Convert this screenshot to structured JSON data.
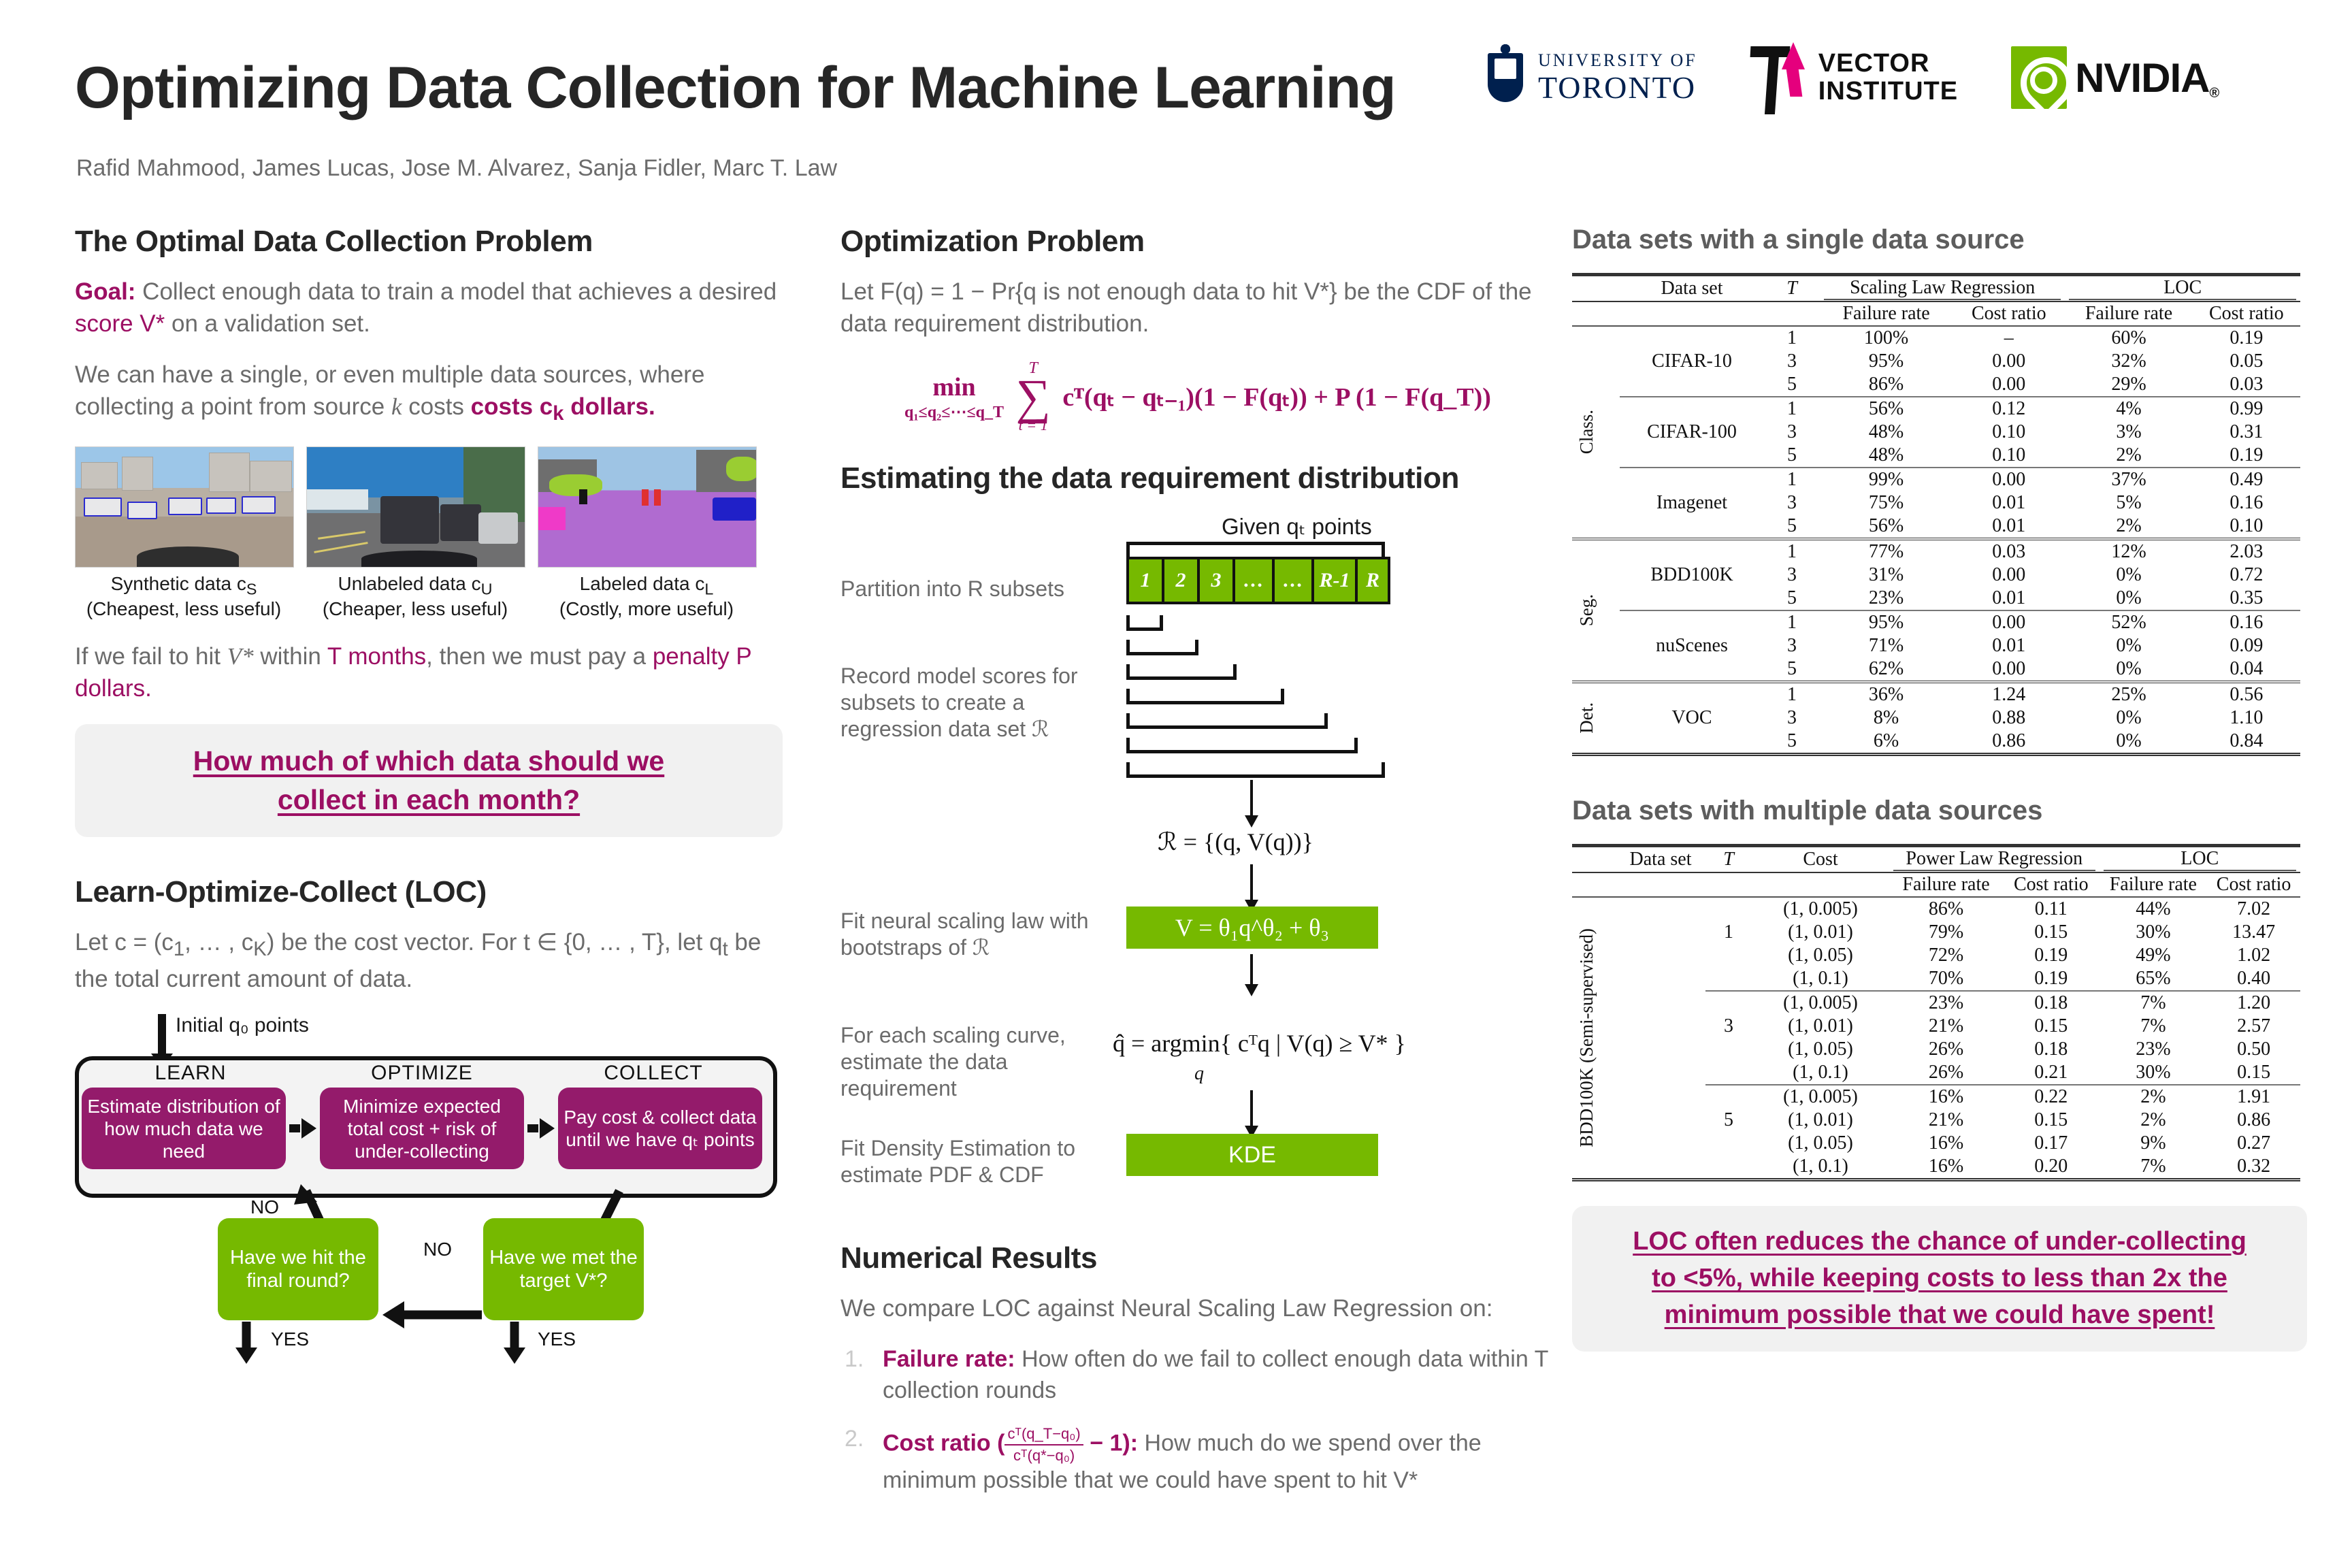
{
  "header": {
    "title": "Optimizing Data Collection for Machine Learning",
    "authors": "Rafid Mahmood, James Lucas, Jose M. Alvarez, Sanja Fidler, Marc T. Law",
    "logos": [
      {
        "name": "university-of-toronto",
        "line1": "UNIVERSITY OF",
        "line2": "TORONTO"
      },
      {
        "name": "vector-institute",
        "line1": "VECTOR",
        "line2": "INSTITUTE"
      },
      {
        "name": "nvidia",
        "wordmark": "NVIDIA",
        "registered": "®"
      }
    ]
  },
  "colors": {
    "magenta": "#9c0f63",
    "green": "#76b900",
    "purple_box": "#941b6b",
    "body_grey": "#6b6b6b",
    "heading": "#262626"
  },
  "section_problem": {
    "heading": "The Optimal Data Collection Problem",
    "goal_label": "Goal:",
    "goal_rest_a": " Collect enough data to train a model that achieves a desired ",
    "goal_highlight": "score V*",
    "goal_rest_b": " on a validation set.",
    "para2_a": "We can have a single, or even multiple data sources, where collecting a point from source ",
    "para2_k": "k",
    "para2_b": " costs ",
    "para2_highlight": "costs c",
    "para2_sub": "k",
    "para2_c": " dollars.",
    "images": [
      {
        "caption_line1": "Synthetic data c",
        "caption_sub": "S",
        "caption_line2": "(Cheapest, less useful)",
        "name": "synthetic-data-thumbnail"
      },
      {
        "caption_line1": "Unlabeled data c",
        "caption_sub": "U",
        "caption_line2": "(Cheaper, less useful)",
        "name": "unlabeled-data-thumbnail"
      },
      {
        "caption_line1": "Labeled data c",
        "caption_sub": "L",
        "caption_line2": "(Costly, more useful)",
        "name": "labeled-data-thumbnail"
      }
    ],
    "penalty_a": "If we fail to hit ",
    "penalty_v": "V*",
    "penalty_b": " within ",
    "penalty_T": "T months",
    "penalty_c": ", then we must pay a ",
    "penalty_d": "penalty P dollars.",
    "callout_line1": "How much of which data should we",
    "callout_line2": "collect in each month?"
  },
  "section_loc": {
    "heading": "Learn-Optimize-Collect (LOC)",
    "intro_a": "Let c = (c",
    "intro_sub1": "1",
    "intro_b": ", … , c",
    "intro_subK": "K",
    "intro_c": ") be the cost vector. For t ∈ {0, … , T}, let q",
    "intro_subt": "t",
    "intro_d": " be the total current amount of data.",
    "initial_label": "Initial q₀ points",
    "loop_labels": [
      "LEARN",
      "OPTIMIZE",
      "COLLECT"
    ],
    "steps": [
      "Estimate distribution of how much data we need",
      "Minimize expected total cost + risk of under-collecting",
      "Pay cost & collect data until we have qₜ points"
    ],
    "decisions": [
      {
        "text": "Have we hit the final round?",
        "name": "decision-final-round"
      },
      {
        "text": "Have we met the target V*?",
        "name": "decision-target-met"
      }
    ],
    "edge_no_1": "NO",
    "edge_no_2": "NO",
    "edge_yes_1": "YES",
    "edge_yes_2": "YES"
  },
  "section_optimization": {
    "heading": "Optimization Problem",
    "text_a": "Let F(q) = 1 − Pr{q is not enough data to hit V*} be the CDF of the data requirement distribution.",
    "equation_min": "min",
    "equation_constraint": "q₁≤q₂≤⋯≤q_T",
    "equation_sum_upper": "T",
    "equation_sum_lower": "t = 1",
    "equation_body": "cᵀ(qₜ − qₜ₋₁)(1 − F(qₜ)) + P (1 − F(q_T))"
  },
  "section_estimating": {
    "heading": "Estimating the data requirement distribution",
    "given_label": "Given qₜ points",
    "partition_label": "Partition into R subsets",
    "subset_cells": [
      "1",
      "2",
      "3",
      "…",
      "…",
      "R-1",
      "R"
    ],
    "record_label": "Record model scores for subsets to create a regression data set ℛ",
    "regression_set": "ℛ = {(q, V(q))}",
    "fit_label": "Fit neural scaling law with bootstraps of ℛ",
    "scaling_law": "V = θ₁q^θ₂ + θ₃",
    "estimate_label": "For each scaling curve, estimate the data requirement",
    "argmin_eq": "q̂ = argmin{ cᵀq | V(q) ≥ V* }",
    "argmin_sub": "q",
    "density_label": "Fit Density Estimation to estimate PDF & CDF",
    "kde_box": "KDE"
  },
  "section_numerical": {
    "heading": "Numerical Results",
    "intro": "We compare LOC against Neural Scaling Law Regression on:",
    "items": [
      {
        "num": "1.",
        "label": "Failure rate:",
        "text": " How often do we fail to collect enough data within T collection rounds"
      },
      {
        "num": "2.",
        "label_a": "Cost ratio (",
        "frac_num": "cᵀ(q_T−q₀)",
        "frac_den": "cᵀ(q*−q₀)",
        "label_b": " − 1):",
        "text": " How much do we spend over the minimum possible that we could have spent to hit V*"
      }
    ]
  },
  "table_single": {
    "heading": "Data sets with a single data source",
    "col_dataset": "Data set",
    "col_T": "T",
    "group_a": "Scaling Law Regression",
    "group_b": "LOC",
    "sub_failure": "Failure rate",
    "sub_cost": "Cost ratio",
    "row_groups": [
      {
        "side": "Class.",
        "blocks": [
          {
            "dataset": "CIFAR-10",
            "rows": [
              {
                "T": "1",
                "slr_fail": "100%",
                "slr_cost": "–",
                "loc_fail": "60%",
                "loc_cost": "0.19"
              },
              {
                "T": "3",
                "slr_fail": "95%",
                "slr_cost": "0.00",
                "loc_fail": "32%",
                "loc_cost": "0.05"
              },
              {
                "T": "5",
                "slr_fail": "86%",
                "slr_cost": "0.00",
                "loc_fail": "29%",
                "loc_cost": "0.03"
              }
            ]
          },
          {
            "dataset": "CIFAR-100",
            "rows": [
              {
                "T": "1",
                "slr_fail": "56%",
                "slr_cost": "0.12",
                "loc_fail": "4%",
                "loc_cost": "0.99"
              },
              {
                "T": "3",
                "slr_fail": "48%",
                "slr_cost": "0.10",
                "loc_fail": "3%",
                "loc_cost": "0.31"
              },
              {
                "T": "5",
                "slr_fail": "48%",
                "slr_cost": "0.10",
                "loc_fail": "2%",
                "loc_cost": "0.19"
              }
            ]
          },
          {
            "dataset": "Imagenet",
            "rows": [
              {
                "T": "1",
                "slr_fail": "99%",
                "slr_cost": "0.00",
                "loc_fail": "37%",
                "loc_cost": "0.49"
              },
              {
                "T": "3",
                "slr_fail": "75%",
                "slr_cost": "0.01",
                "loc_fail": "5%",
                "loc_cost": "0.16"
              },
              {
                "T": "5",
                "slr_fail": "56%",
                "slr_cost": "0.01",
                "loc_fail": "2%",
                "loc_cost": "0.10"
              }
            ]
          }
        ]
      },
      {
        "side": "Seg.",
        "blocks": [
          {
            "dataset": "BDD100K",
            "rows": [
              {
                "T": "1",
                "slr_fail": "77%",
                "slr_cost": "0.03",
                "loc_fail": "12%",
                "loc_cost": "2.03"
              },
              {
                "T": "3",
                "slr_fail": "31%",
                "slr_cost": "0.00",
                "loc_fail": "0%",
                "loc_cost": "0.72"
              },
              {
                "T": "5",
                "slr_fail": "23%",
                "slr_cost": "0.01",
                "loc_fail": "0%",
                "loc_cost": "0.35"
              }
            ]
          },
          {
            "dataset": "nuScenes",
            "rows": [
              {
                "T": "1",
                "slr_fail": "95%",
                "slr_cost": "0.00",
                "loc_fail": "52%",
                "loc_cost": "0.16"
              },
              {
                "T": "3",
                "slr_fail": "71%",
                "slr_cost": "0.01",
                "loc_fail": "0%",
                "loc_cost": "0.09"
              },
              {
                "T": "5",
                "slr_fail": "62%",
                "slr_cost": "0.00",
                "loc_fail": "0%",
                "loc_cost": "0.04"
              }
            ]
          }
        ]
      },
      {
        "side": "Det.",
        "blocks": [
          {
            "dataset": "VOC",
            "rows": [
              {
                "T": "1",
                "slr_fail": "36%",
                "slr_cost": "1.24",
                "loc_fail": "25%",
                "loc_cost": "0.56"
              },
              {
                "T": "3",
                "slr_fail": "8%",
                "slr_cost": "0.88",
                "loc_fail": "0%",
                "loc_cost": "1.10"
              },
              {
                "T": "5",
                "slr_fail": "6%",
                "slr_cost": "0.86",
                "loc_fail": "0%",
                "loc_cost": "0.84"
              }
            ]
          }
        ]
      }
    ]
  },
  "table_multi": {
    "heading": "Data sets with multiple data sources",
    "col_dataset": "Data set",
    "col_T": "T",
    "col_cost": "Cost",
    "group_a": "Power Law Regression",
    "group_b": "LOC",
    "sub_failure": "Failure rate",
    "sub_cost": "Cost ratio",
    "side_label": "BDD100K (Semi-supervised)",
    "blocks": [
      {
        "T": "1",
        "rows": [
          {
            "cost": "(1, 0.005)",
            "plr_fail": "86%",
            "plr_cost": "0.11",
            "loc_fail": "44%",
            "loc_cost": "7.02"
          },
          {
            "cost": "(1, 0.01)",
            "plr_fail": "79%",
            "plr_cost": "0.15",
            "loc_fail": "30%",
            "loc_cost": "13.47"
          },
          {
            "cost": "(1, 0.05)",
            "plr_fail": "72%",
            "plr_cost": "0.19",
            "loc_fail": "49%",
            "loc_cost": "1.02"
          },
          {
            "cost": "(1, 0.1)",
            "plr_fail": "70%",
            "plr_cost": "0.19",
            "loc_fail": "65%",
            "loc_cost": "0.40"
          }
        ]
      },
      {
        "T": "3",
        "rows": [
          {
            "cost": "(1, 0.005)",
            "plr_fail": "23%",
            "plr_cost": "0.18",
            "loc_fail": "7%",
            "loc_cost": "1.20"
          },
          {
            "cost": "(1, 0.01)",
            "plr_fail": "21%",
            "plr_cost": "0.15",
            "loc_fail": "7%",
            "loc_cost": "2.57"
          },
          {
            "cost": "(1, 0.05)",
            "plr_fail": "26%",
            "plr_cost": "0.18",
            "loc_fail": "23%",
            "loc_cost": "0.50"
          },
          {
            "cost": "(1, 0.1)",
            "plr_fail": "26%",
            "plr_cost": "0.21",
            "loc_fail": "30%",
            "loc_cost": "0.15"
          }
        ]
      },
      {
        "T": "5",
        "rows": [
          {
            "cost": "(1, 0.005)",
            "plr_fail": "16%",
            "plr_cost": "0.22",
            "loc_fail": "2%",
            "loc_cost": "1.91"
          },
          {
            "cost": "(1, 0.01)",
            "plr_fail": "21%",
            "plr_cost": "0.15",
            "loc_fail": "2%",
            "loc_cost": "0.86"
          },
          {
            "cost": "(1, 0.05)",
            "plr_fail": "16%",
            "plr_cost": "0.17",
            "loc_fail": "9%",
            "loc_cost": "0.27"
          },
          {
            "cost": "(1, 0.1)",
            "plr_fail": "16%",
            "plr_cost": "0.20",
            "loc_fail": "7%",
            "loc_cost": "0.32"
          }
        ]
      }
    ]
  },
  "conclusion": {
    "line1": "LOC often reduces the chance of under-collecting",
    "line2": "to <5%, while keeping costs to less than 2x the",
    "line3": "minimum possible that we could have spent!"
  }
}
